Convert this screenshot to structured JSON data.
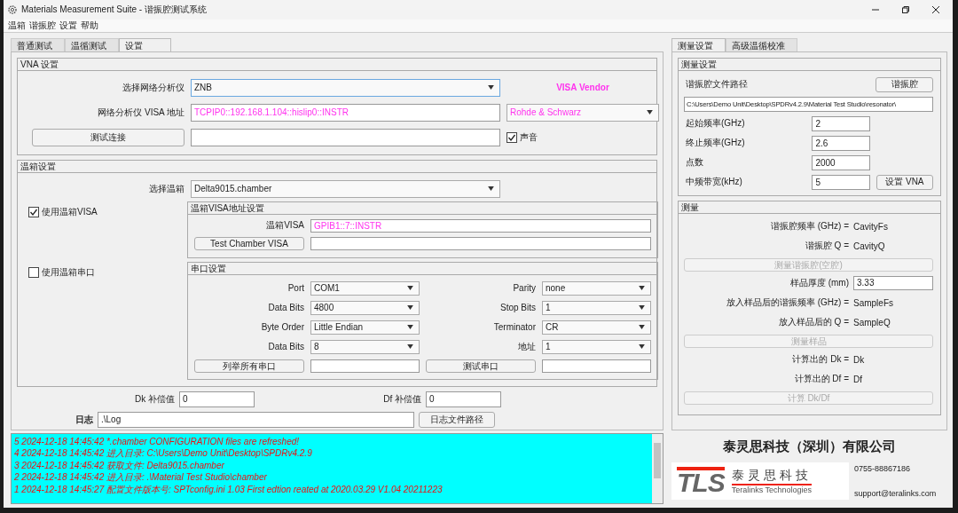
{
  "window": {
    "title": "Materials Measurement Suite - 谐振腔测试系统"
  },
  "menu": [
    "温箱",
    "谐振腔",
    "设置",
    "帮助"
  ],
  "left_tabs": [
    {
      "label": "普通测试",
      "selected": false
    },
    {
      "label": "温循测试",
      "selected": false
    },
    {
      "label": "设置",
      "selected": true
    }
  ],
  "vna": {
    "title": "VNA 设置",
    "analyzer_label": "选择网络分析仪",
    "analyzer_value": "ZNB",
    "analyzer_focused": true,
    "vendor_title": "VISA Vendor",
    "visa_label": "网络分析仪 VISA 地址",
    "visa_value": "TCPIP0::192.168.1.104::hislip0::INSTR",
    "vendor_value": "Rohde & Schwarz",
    "test_button": "测试连接",
    "sound": {
      "label": "声音",
      "checked": true
    }
  },
  "chamber": {
    "title": "温箱设置",
    "select_label": "选择温箱",
    "select_value": "Delta9015.chamber",
    "use_visa": {
      "label": "使用温箱VISA",
      "checked": true
    },
    "use_serial": {
      "label": "使用温箱串口",
      "checked": false
    },
    "visa_group": {
      "title": "温箱VISA地址设置",
      "visa_label": "温箱VISA",
      "visa_value": "GPIB1::7::INSTR",
      "test_button": "Test Chamber VISA"
    },
    "serial_group": {
      "title": "串口设置",
      "fields": [
        {
          "label": "Port",
          "value": "COM1"
        },
        {
          "label": "Parity",
          "value": "none"
        },
        {
          "label": "Data Bits",
          "value": "4800"
        },
        {
          "label": "Stop Bits",
          "value": "1"
        },
        {
          "label": "Byte Order",
          "value": "Little Endian"
        },
        {
          "label": "Terminator",
          "value": "CR"
        },
        {
          "label": "Data Bits",
          "value": "8"
        },
        {
          "label": "地址",
          "value": "1"
        }
      ],
      "list_button": "列举所有串口",
      "test_button": "测试串口"
    }
  },
  "compensation": {
    "dk_label": "Dk 补偿值",
    "dk_value": "0",
    "df_label": "Df 补偿值",
    "df_value": "0"
  },
  "log": {
    "label": "日志",
    "value": ".\\Log",
    "button": "日志文件路径"
  },
  "right_tabs": [
    {
      "label": "测量设置",
      "selected": true
    },
    {
      "label": "高级温循校准",
      "selected": false
    }
  ],
  "measurement_settings": {
    "title": "测量设置",
    "path_label": "谐振腔文件路径",
    "resonator_button": "谐振腔",
    "path_value": "C:\\Users\\Demo Unit\\Desktop\\SPDRv4.2.9\\Material Test Studio\\resonator\\",
    "params": [
      {
        "label": "起始频率(GHz)",
        "value": "2"
      },
      {
        "label": "终止频率(GHz)",
        "value": "2.6"
      },
      {
        "label": "点数",
        "value": "2000"
      },
      {
        "label": "中频带宽(kHz)",
        "value": "5"
      }
    ],
    "set_vna_button": "设置 VNA"
  },
  "measurement": {
    "title": "测量",
    "rows": [
      {
        "kind": "readout",
        "label": "谐振腔频率 (GHz) =",
        "value": "CavityFs"
      },
      {
        "kind": "readout",
        "label": "谐振腔 Q =",
        "value": "CavityQ"
      },
      {
        "kind": "button",
        "label": "测量谐振腔(空腔)",
        "disabled": true
      },
      {
        "kind": "input",
        "label": "样品厚度 (mm)",
        "value": "3.33"
      },
      {
        "kind": "readout",
        "label": "放入样品后的谐振频率 (GHz) =",
        "value": "SampleFs"
      },
      {
        "kind": "readout",
        "label": "放入样品后的 Q =",
        "value": "SampleQ"
      },
      {
        "kind": "button",
        "label": "测量样品",
        "disabled": true
      },
      {
        "kind": "readout",
        "label": "计算出的 Dk =",
        "value": "Dk"
      },
      {
        "kind": "readout",
        "label": "计算出的  Df =",
        "value": "Df"
      },
      {
        "kind": "button",
        "label": "计算 Dk/Df",
        "disabled": true
      }
    ]
  },
  "messages": [
    "5 2024-12-18 14:45:42 *.chamber CONFIGURATION files are refreshed!",
    "4 2024-12-18 14:45:42 进入目录: C:\\Users\\Demo Unit\\Desktop\\SPDRv4.2.9",
    "3 2024-12-18 14:45:42 获取文件: Delta9015.chamber",
    "2 2024-12-18 14:45:42 进入目录: .\\Material Test Studio\\chamber",
    "1 2024-12-18 14:45:27 配置文件版本号: SPTconfig.ini 1.03 First edtion reated at 2020.03.29 V1.04 20211223"
  ],
  "company": {
    "name": "泰灵思科技（深圳）有限公司",
    "logo_letters": "TLS",
    "logo_cn": "泰灵思科技",
    "logo_en": "Teralinks Technologies",
    "phone": "0755-88867186",
    "email": "support@teralinks.com"
  }
}
